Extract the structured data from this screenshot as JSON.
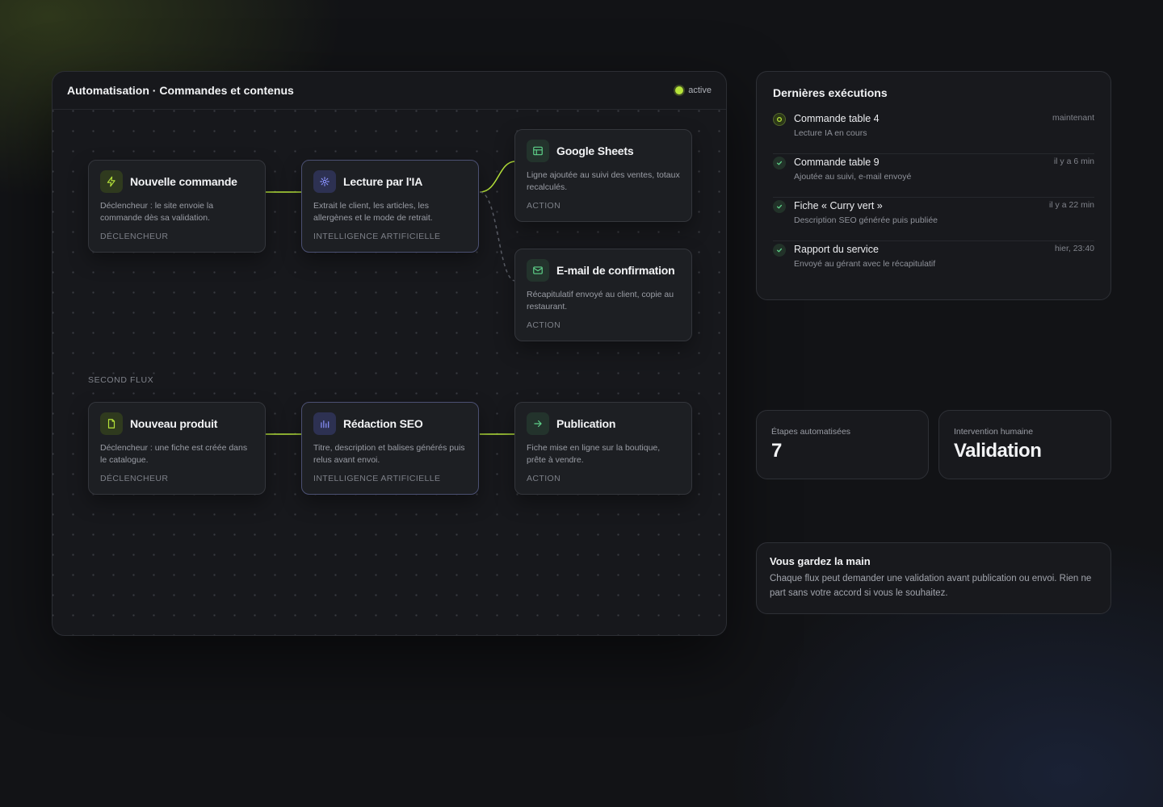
{
  "canvas": {
    "title": "Automatisation · Commandes et contenus",
    "status": "active",
    "section_label": "SECOND FLUX",
    "nodes": [
      {
        "title": "Nouvelle commande",
        "description": "Déclencheur : le site envoie la commande dès sa validation.",
        "kind": "DÉCLENCHEUR",
        "icon": "bolt-icon"
      },
      {
        "title": "Lecture par l'IA",
        "description": "Extrait le client, les articles, les allergènes et le mode de retrait.",
        "kind": "INTELLIGENCE ARTIFICIELLE",
        "icon": "sparkle-icon"
      },
      {
        "title": "Google Sheets",
        "description": "Ligne ajoutée au suivi des ventes, totaux recalculés.",
        "kind": "ACTION",
        "icon": "table-icon"
      },
      {
        "title": "E-mail de confirmation",
        "description": "Récapitulatif envoyé au client, copie au restaurant.",
        "kind": "ACTION",
        "icon": "mail-icon"
      },
      {
        "title": "Nouveau produit",
        "description": "Déclencheur : une fiche est créée dans le catalogue.",
        "kind": "DÉCLENCHEUR",
        "icon": "file-icon"
      },
      {
        "title": "Rédaction SEO",
        "description": "Titre, description et balises générés puis relus avant envoi.",
        "kind": "INTELLIGENCE ARTIFICIELLE",
        "icon": "chart-bars-icon"
      },
      {
        "title": "Publication",
        "description": "Fiche mise en ligne sur la boutique, prête à vendre.",
        "kind": "ACTION",
        "icon": "arrow-right-icon"
      }
    ]
  },
  "executions": {
    "title": "Dernières exécutions",
    "items": [
      {
        "name": "Commande table 4",
        "detail": "Lecture IA en cours",
        "time": "maintenant",
        "state": "pending"
      },
      {
        "name": "Commande table 9",
        "detail": "Ajoutée au suivi, e-mail envoyé",
        "time": "il y a 6 min",
        "state": "done"
      },
      {
        "name": "Fiche « Curry vert »",
        "detail": "Description SEO générée puis publiée",
        "time": "il y a 22 min",
        "state": "done"
      },
      {
        "name": "Rapport du service",
        "detail": "Envoyé au gérant avec le récapitulatif",
        "time": "hier, 23:40",
        "state": "done"
      }
    ]
  },
  "stats": {
    "steps_label": "Étapes automatisées",
    "steps_value": "7",
    "human_label": "Intervention humaine",
    "human_value": "Validation"
  },
  "note": {
    "title": "Vous gardez la main",
    "text": "Chaque flux peut demander une validation avant publication ou envoi. Rien ne part sans votre accord si vous le souhaitez."
  },
  "colors": {
    "accent": "#b6e33a",
    "ai": "#8b93ff",
    "success": "#5fd38a"
  }
}
